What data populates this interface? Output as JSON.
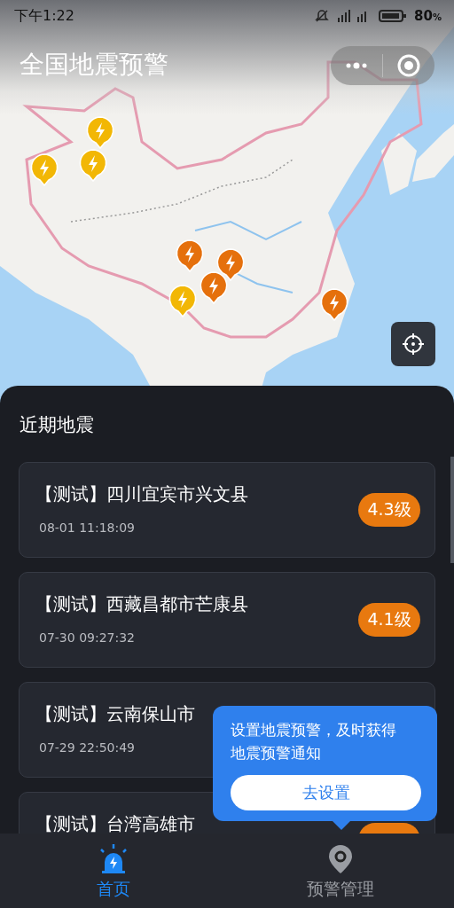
{
  "status_bar": {
    "time": "下午1:22",
    "battery": "80",
    "battery_unit": "%"
  },
  "header": {
    "title": "全国地震预警"
  },
  "map": {
    "markers": [
      {
        "color": "#f2b705"
      },
      {
        "color": "#f2b705"
      },
      {
        "color": "#f2b705"
      },
      {
        "color": "#e5700c"
      },
      {
        "color": "#e5700c"
      },
      {
        "color": "#e5700c"
      },
      {
        "color": "#f2b705"
      },
      {
        "color": "#e5700c"
      }
    ]
  },
  "recent": {
    "title": "近期地震",
    "items": [
      {
        "title": "【测试】四川宜宾市兴文县",
        "time": "08-01 11:18:09",
        "magnitude": "4.3级",
        "color": "#e8790f"
      },
      {
        "title": "【测试】西藏昌都市芒康县",
        "time": "07-30 09:27:32",
        "magnitude": "4.1级",
        "color": "#e8790f"
      },
      {
        "title": "【测试】云南保山市",
        "time": "07-29 22:50:49"
      },
      {
        "title": "【测试】台湾高雄市",
        "color": "#e8790f"
      }
    ]
  },
  "tooltip": {
    "text": "设置地震预警，及时获得地震预警通知",
    "button": "去设置"
  },
  "nav": [
    {
      "label": "首页",
      "selected": true
    },
    {
      "label": "预警管理",
      "selected": false
    }
  ]
}
